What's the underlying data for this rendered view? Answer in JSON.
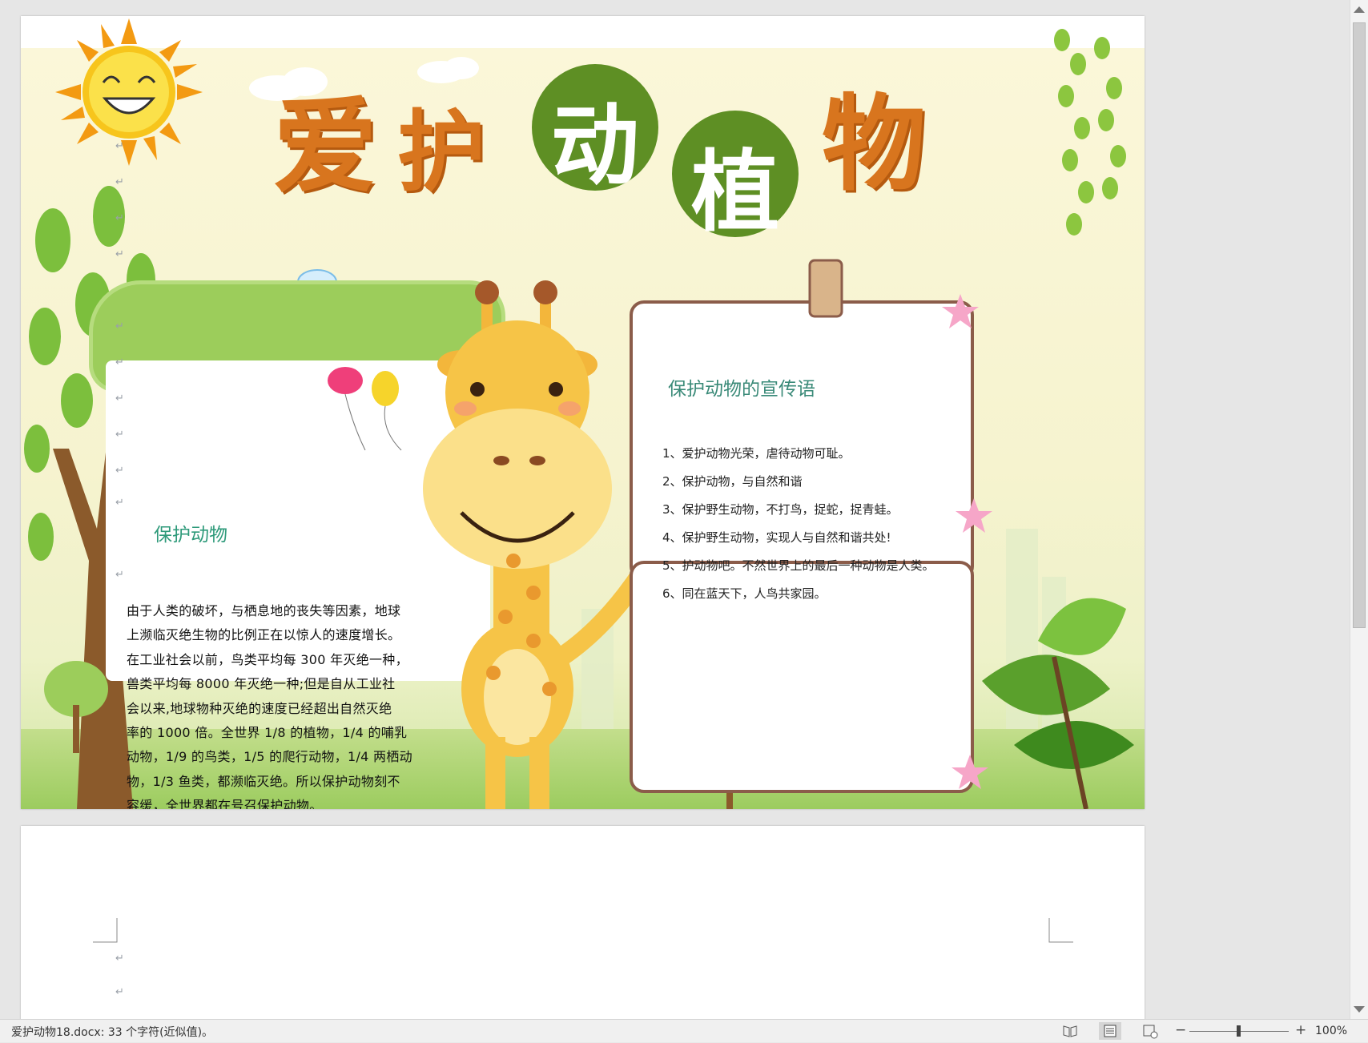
{
  "poster": {
    "title_chars": [
      "爱",
      "护",
      "动",
      "植",
      "物"
    ],
    "left_panel": {
      "heading": "保护动物",
      "body_lines": [
        "由于人类的破坏，与栖息地的丧失等因素，地球",
        "上濒临灭绝生物的比例正在以惊人的速度增长。",
        "在工业社会以前，鸟类平均每 300 年灭绝一种，",
        "兽类平均每  8000  年灭绝一种;但是自从工业社",
        "会以来,地球物种灭绝的速度已经超出自然灭绝",
        "率的 1000 倍。全世界 1/8 的植物，1/4 的哺乳",
        "动物，1/9 的鸟类，1/5 的爬行动物，1/4 两栖动",
        "物，1/3 鱼类，都濒临灭绝。所以保护动物刻不",
        "容缓，全世界都在号召保护动物。"
      ]
    },
    "right_panel": {
      "heading": "保护动物的宣传语",
      "slogans": [
        "1、爱护动物光荣，虐待动物可耻。",
        "2、保护动物，与自然和谐",
        "3、保护野生动物，不打鸟，捉蛇，捉青蛙。",
        "4、保护野生动物，实现人与自然和谐共处!",
        "5、护动物吧。不然世界上的最后一种动物是人类。",
        "6、同在蓝天下，人鸟共家园。"
      ]
    },
    "paragraph_mark": "↵"
  },
  "status_bar": {
    "doc_info": "爱护动物18.docx: 33 个字符(近似值)。",
    "view_icons": [
      "read-mode-icon",
      "print-layout-icon",
      "web-layout-icon"
    ],
    "zoom_minus": "−",
    "zoom_plus": "+",
    "zoom_level": "100%",
    "zoom_fraction": 0.5
  },
  "colors": {
    "title_orange": "#d8751e",
    "title_green": "#5e8f24",
    "left_heading": "#2e9a7a",
    "right_heading": "#3a8a78"
  }
}
